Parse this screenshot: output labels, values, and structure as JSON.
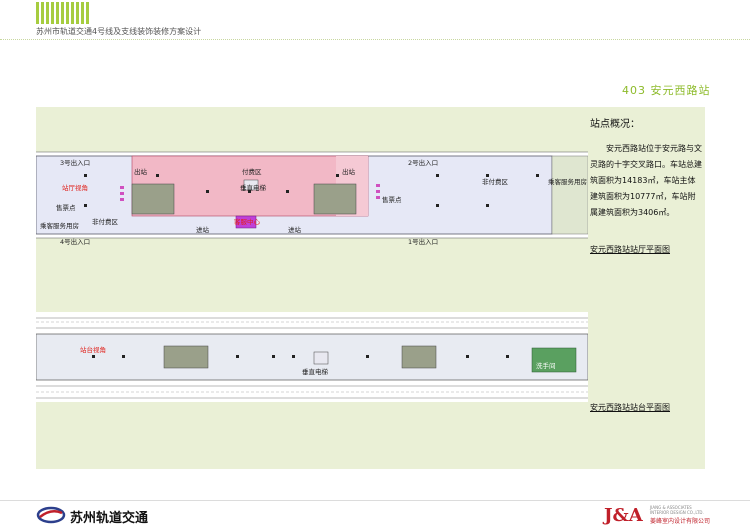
{
  "header": {
    "project_title": "苏州市轨道交通4号线及支线装饰装修方案设计",
    "section_title": "403 安元西路站"
  },
  "overview": {
    "title": "站点概况：",
    "body": "安元西路站位于安元路与文灵路的十字交叉路口。车站总建筑面积为14183㎡，车站主体建筑面积为10777㎡，车站附属建筑面积为3406㎡。"
  },
  "captions": {
    "hall_plan": "安元西路站站厅平面图",
    "platform_plan": "安元西路站站台平面图"
  },
  "hall_labels": {
    "exit3": "3号出入口",
    "exit4": "4号出入口",
    "exit2": "2号出入口",
    "exit1": "1号出入口",
    "hall_view": "站厅视角",
    "ticket_left": "售票点",
    "ticket_right": "售票点",
    "unpaid_left": "非付费区",
    "unpaid_right": "非付费区",
    "paid": "付费区",
    "elevator": "垂直电梯",
    "service_center": "客服中心",
    "service_room_left": "乘客服务用房",
    "service_room_right": "乘客服务用房",
    "out_left": "出站",
    "out_right": "出站",
    "in_left": "进站",
    "in_right": "进站"
  },
  "platform_labels": {
    "platform_view": "站台视角",
    "elevator": "垂直电梯",
    "washroom": "洗手间"
  },
  "footer": {
    "brand": "苏州轨道交通",
    "design_mark": "J&A",
    "design_en_1": "JIANG & ASSOCIATES",
    "design_en_2": "INTERIOR DESIGN CO.,LTD.",
    "design_cn": "姜峰室内设计有限公司"
  },
  "colors": {
    "accent_green": "#8dbb2a",
    "panel_bg": "#eaf0d6",
    "paid_zone": "#f2b8c6",
    "hall_floor": "#e6e8f6",
    "brand_red": "#c0202a",
    "brand_blue": "#2c3f8c"
  }
}
